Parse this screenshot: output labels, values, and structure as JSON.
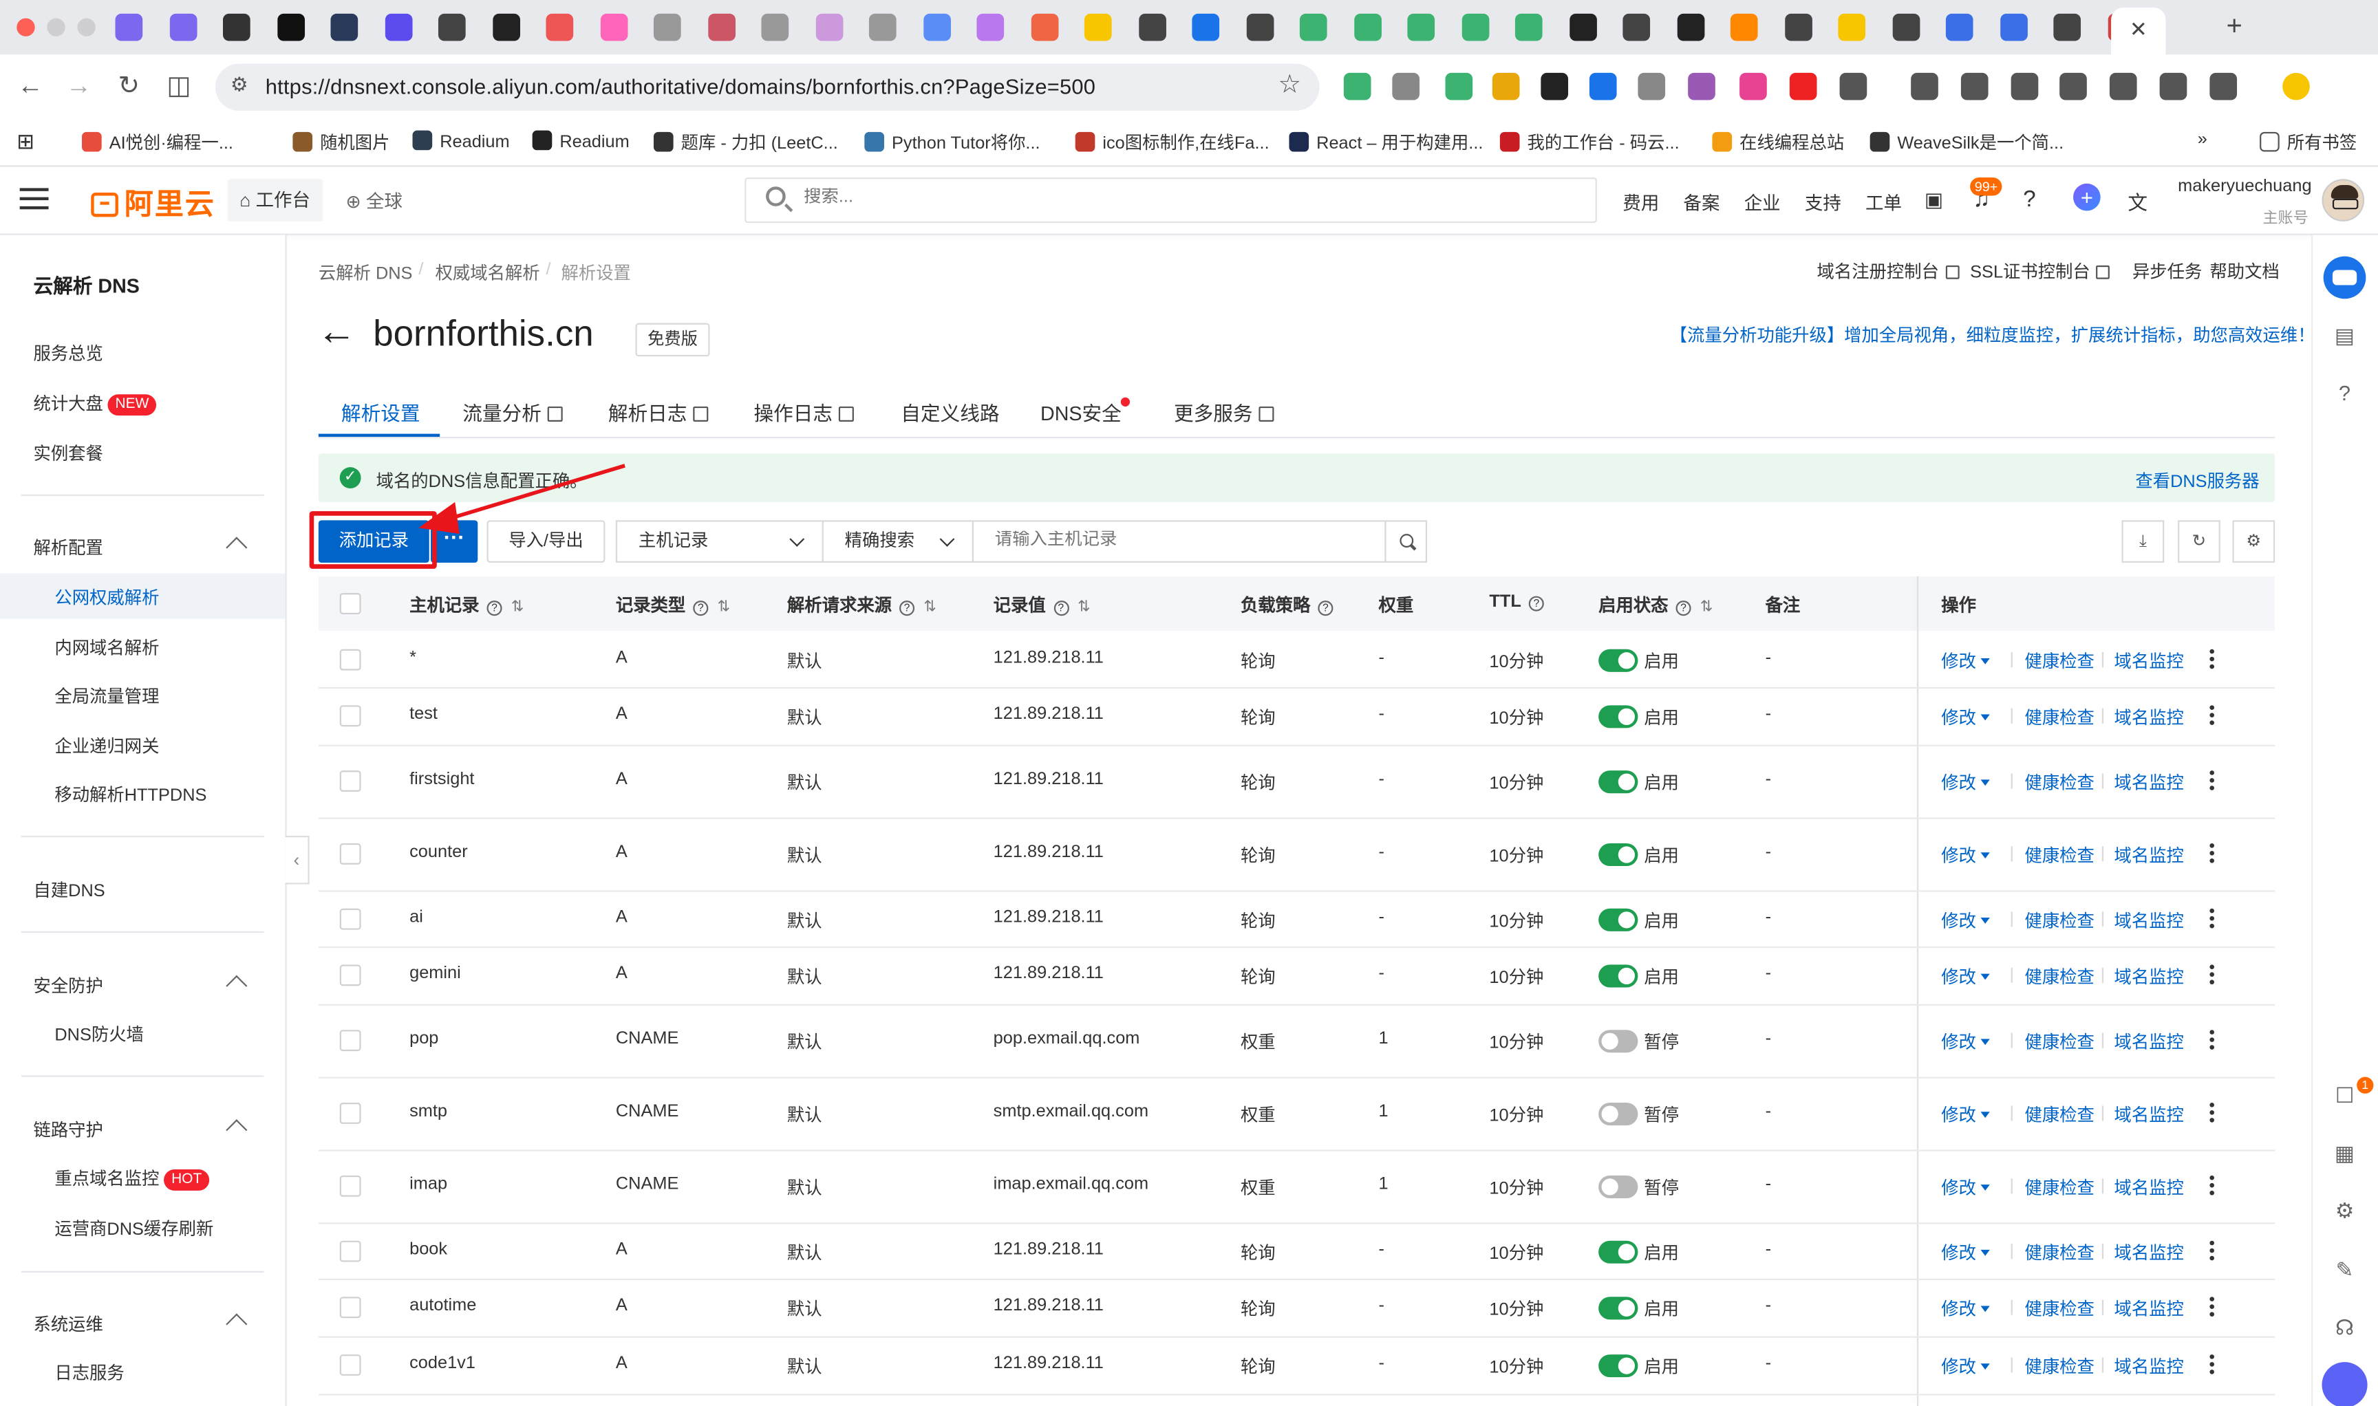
{
  "browser": {
    "url": "https://dnsnext.console.aliyun.com/authoritative/domains/bornforthis.cn?PageSize=500",
    "bookmarks": [
      "AI悦创·编程一...",
      "随机图片",
      "Readium",
      "Readium",
      "题库 - 力扣 (LeetC...",
      "Python Tutor将你...",
      "ico图标制作,在线Fa...",
      "React – 用于构建用...",
      "我的工作台 - 码云...",
      "在线编程总站",
      "WeaveSilk是一个简..."
    ],
    "all_bookmarks": "所有书签"
  },
  "header": {
    "logo": "阿里云",
    "workbench": "工作台",
    "global": "全球",
    "search_placeholder": "搜索...",
    "links": [
      "费用",
      "备案",
      "企业",
      "支持",
      "工单"
    ],
    "notif_badge": "99+",
    "user_name": "makeryuechuang",
    "user_sub": "主账号"
  },
  "sidebar": {
    "title": "云解析 DNS",
    "top_items": [
      "服务总览",
      "统计大盘",
      "实例套餐"
    ],
    "new_tag": "NEW",
    "hot_tag": "HOT",
    "group_parse": "解析配置",
    "parse_items": [
      "公网权威解析",
      "内网域名解析",
      "全局流量管理",
      "企业递归网关",
      "移动解析HTTPDNS"
    ],
    "self_dns": "自建DNS",
    "group_security": "安全防护",
    "security_items": [
      "DNS防火墙"
    ],
    "group_link": "链路守护",
    "link_items": [
      "重点域名监控",
      "运营商DNS缓存刷新"
    ],
    "group_ops": "系统运维",
    "ops_items": [
      "日志服务"
    ]
  },
  "main": {
    "breadcrumb": [
      "云解析 DNS",
      "权威域名解析",
      "解析设置"
    ],
    "top_links": [
      "域名注册控制台",
      "SSL证书控制台",
      "异步任务",
      "帮助文档"
    ],
    "domain": "bornforthis.cn",
    "edition": "免费版",
    "promo": "【流量分析功能升级】增加全局视角，细粒度监控，扩展统计指标，助您高效运维！",
    "tabs": [
      "解析设置",
      "流量分析",
      "解析日志",
      "操作日志",
      "自定义线路",
      "DNS安全",
      "更多服务"
    ],
    "banner": "域名的DNS信息配置正确。",
    "banner_link": "查看DNS服务器",
    "add_button": "添加记录",
    "more_button": "···",
    "io_button": "导入/导出",
    "filter_field": "主机记录",
    "filter_mode": "精确搜索",
    "search_placeholder": "请输入主机记录"
  },
  "table": {
    "headers": [
      "主机记录",
      "记录类型",
      "解析请求来源",
      "记录值",
      "负载策略",
      "权重",
      "TTL",
      "启用状态",
      "备注",
      "操作"
    ],
    "actions": [
      "修改",
      "健康检查",
      "域名监控"
    ],
    "rows": [
      {
        "host": "*",
        "type": "A",
        "source": "默认",
        "value": "121.89.218.11",
        "policy": "轮询",
        "weight": "-",
        "ttl": "10分钟",
        "status": "启用",
        "on": true,
        "note": "-"
      },
      {
        "host": "test",
        "type": "A",
        "source": "默认",
        "value": "121.89.218.11",
        "policy": "轮询",
        "weight": "-",
        "ttl": "10分钟",
        "status": "启用",
        "on": true,
        "note": "-"
      },
      {
        "host": "firstsight",
        "type": "A",
        "source": "默认",
        "value": "121.89.218.11",
        "policy": "轮询",
        "weight": "-",
        "ttl": "10分钟",
        "status": "启用",
        "on": true,
        "note": "-"
      },
      {
        "host": "counter",
        "type": "A",
        "source": "默认",
        "value": "121.89.218.11",
        "policy": "轮询",
        "weight": "-",
        "ttl": "10分钟",
        "status": "启用",
        "on": true,
        "note": "-"
      },
      {
        "host": "ai",
        "type": "A",
        "source": "默认",
        "value": "121.89.218.11",
        "policy": "轮询",
        "weight": "-",
        "ttl": "10分钟",
        "status": "启用",
        "on": true,
        "note": "-"
      },
      {
        "host": "gemini",
        "type": "A",
        "source": "默认",
        "value": "121.89.218.11",
        "policy": "轮询",
        "weight": "-",
        "ttl": "10分钟",
        "status": "启用",
        "on": true,
        "note": "-"
      },
      {
        "host": "pop",
        "type": "CNAME",
        "source": "默认",
        "value": "pop.exmail.qq.com",
        "policy": "权重",
        "weight": "1",
        "ttl": "10分钟",
        "status": "暂停",
        "on": false,
        "note": "-"
      },
      {
        "host": "smtp",
        "type": "CNAME",
        "source": "默认",
        "value": "smtp.exmail.qq.com",
        "policy": "权重",
        "weight": "1",
        "ttl": "10分钟",
        "status": "暂停",
        "on": false,
        "note": "-"
      },
      {
        "host": "imap",
        "type": "CNAME",
        "source": "默认",
        "value": "imap.exmail.qq.com",
        "policy": "权重",
        "weight": "1",
        "ttl": "10分钟",
        "status": "暂停",
        "on": false,
        "note": "-"
      },
      {
        "host": "book",
        "type": "A",
        "source": "默认",
        "value": "121.89.218.11",
        "policy": "轮询",
        "weight": "-",
        "ttl": "10分钟",
        "status": "启用",
        "on": true,
        "note": "-"
      },
      {
        "host": "autotime",
        "type": "A",
        "source": "默认",
        "value": "121.89.218.11",
        "policy": "轮询",
        "weight": "-",
        "ttl": "10分钟",
        "status": "启用",
        "on": true,
        "note": "-"
      },
      {
        "host": "code1v1",
        "type": "A",
        "source": "默认",
        "value": "121.89.218.11",
        "policy": "轮询",
        "weight": "-",
        "ttl": "10分钟",
        "status": "启用",
        "on": true,
        "note": "-"
      }
    ]
  },
  "rail": {
    "msg_badge": "1"
  },
  "colors": {
    "primary": "#0064c8",
    "brand": "#ff6a00",
    "success": "#1e9e51",
    "annotation": "#e8151b"
  }
}
